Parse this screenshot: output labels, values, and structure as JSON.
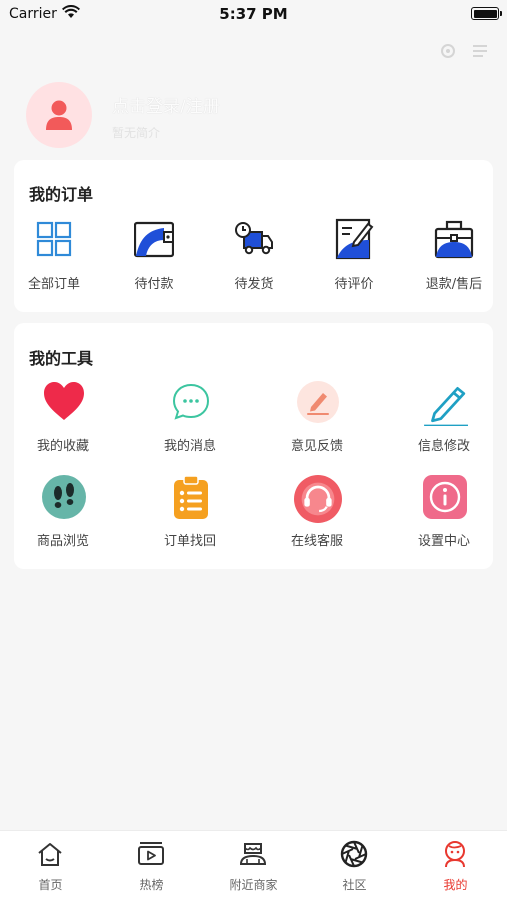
{
  "status_bar": {
    "carrier": "Carrier",
    "time": "5:37 PM"
  },
  "profile": {
    "username": "点击登录/注册",
    "subtitle": "暂无简介"
  },
  "orders": {
    "title": "我的订单",
    "items": [
      {
        "label": "全部订单",
        "icon": "grid-icon"
      },
      {
        "label": "待付款",
        "icon": "wallet-icon"
      },
      {
        "label": "待发货",
        "icon": "delivery-truck-icon"
      },
      {
        "label": "待评价",
        "icon": "review-pen-icon"
      },
      {
        "label": "退款/售后",
        "icon": "briefcase-icon"
      }
    ]
  },
  "tools": {
    "title": "我的工具",
    "items": [
      {
        "label": "我的收藏",
        "icon": "heart-icon",
        "color": "#ee2a4a"
      },
      {
        "label": "我的消息",
        "icon": "chat-bubble-icon",
        "color": "#3cc5a0"
      },
      {
        "label": "意见反馈",
        "icon": "feedback-pen-icon",
        "color": "#f08a70"
      },
      {
        "label": "信息修改",
        "icon": "edit-pencil-icon",
        "color": "#1fa0c4"
      },
      {
        "label": "商品浏览",
        "icon": "footprints-icon",
        "color": "#66b5a8"
      },
      {
        "label": "订单找回",
        "icon": "clipboard-list-icon",
        "color": "#f5a020"
      },
      {
        "label": "在线客服",
        "icon": "headset-icon",
        "color": "#f05b64"
      },
      {
        "label": "设置中心",
        "icon": "info-icon",
        "color": "#ef6a8a"
      }
    ]
  },
  "tabbar": {
    "items": [
      {
        "label": "首页",
        "icon": "home-icon"
      },
      {
        "label": "热榜",
        "icon": "video-play-icon"
      },
      {
        "label": "附近商家",
        "icon": "shop-icon"
      },
      {
        "label": "社区",
        "icon": "aperture-icon"
      },
      {
        "label": "我的",
        "icon": "profile-icon",
        "active": true
      }
    ]
  },
  "colors": {
    "accent": "#e8382f",
    "background": "#f6f6f6"
  }
}
